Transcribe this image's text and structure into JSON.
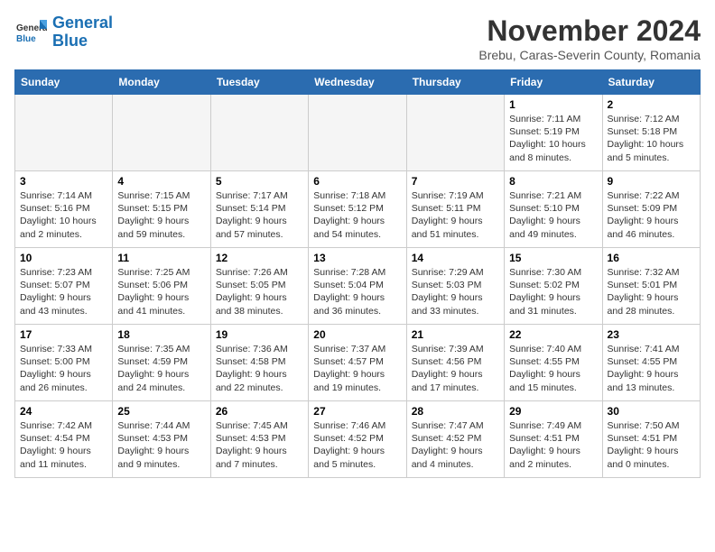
{
  "header": {
    "logo_line1": "General",
    "logo_line2": "Blue",
    "month_title": "November 2024",
    "subtitle": "Brebu, Caras-Severin County, Romania"
  },
  "weekdays": [
    "Sunday",
    "Monday",
    "Tuesday",
    "Wednesday",
    "Thursday",
    "Friday",
    "Saturday"
  ],
  "weeks": [
    [
      {
        "day": "",
        "info": ""
      },
      {
        "day": "",
        "info": ""
      },
      {
        "day": "",
        "info": ""
      },
      {
        "day": "",
        "info": ""
      },
      {
        "day": "",
        "info": ""
      },
      {
        "day": "1",
        "info": "Sunrise: 7:11 AM\nSunset: 5:19 PM\nDaylight: 10 hours and 8 minutes."
      },
      {
        "day": "2",
        "info": "Sunrise: 7:12 AM\nSunset: 5:18 PM\nDaylight: 10 hours and 5 minutes."
      }
    ],
    [
      {
        "day": "3",
        "info": "Sunrise: 7:14 AM\nSunset: 5:16 PM\nDaylight: 10 hours and 2 minutes."
      },
      {
        "day": "4",
        "info": "Sunrise: 7:15 AM\nSunset: 5:15 PM\nDaylight: 9 hours and 59 minutes."
      },
      {
        "day": "5",
        "info": "Sunrise: 7:17 AM\nSunset: 5:14 PM\nDaylight: 9 hours and 57 minutes."
      },
      {
        "day": "6",
        "info": "Sunrise: 7:18 AM\nSunset: 5:12 PM\nDaylight: 9 hours and 54 minutes."
      },
      {
        "day": "7",
        "info": "Sunrise: 7:19 AM\nSunset: 5:11 PM\nDaylight: 9 hours and 51 minutes."
      },
      {
        "day": "8",
        "info": "Sunrise: 7:21 AM\nSunset: 5:10 PM\nDaylight: 9 hours and 49 minutes."
      },
      {
        "day": "9",
        "info": "Sunrise: 7:22 AM\nSunset: 5:09 PM\nDaylight: 9 hours and 46 minutes."
      }
    ],
    [
      {
        "day": "10",
        "info": "Sunrise: 7:23 AM\nSunset: 5:07 PM\nDaylight: 9 hours and 43 minutes."
      },
      {
        "day": "11",
        "info": "Sunrise: 7:25 AM\nSunset: 5:06 PM\nDaylight: 9 hours and 41 minutes."
      },
      {
        "day": "12",
        "info": "Sunrise: 7:26 AM\nSunset: 5:05 PM\nDaylight: 9 hours and 38 minutes."
      },
      {
        "day": "13",
        "info": "Sunrise: 7:28 AM\nSunset: 5:04 PM\nDaylight: 9 hours and 36 minutes."
      },
      {
        "day": "14",
        "info": "Sunrise: 7:29 AM\nSunset: 5:03 PM\nDaylight: 9 hours and 33 minutes."
      },
      {
        "day": "15",
        "info": "Sunrise: 7:30 AM\nSunset: 5:02 PM\nDaylight: 9 hours and 31 minutes."
      },
      {
        "day": "16",
        "info": "Sunrise: 7:32 AM\nSunset: 5:01 PM\nDaylight: 9 hours and 28 minutes."
      }
    ],
    [
      {
        "day": "17",
        "info": "Sunrise: 7:33 AM\nSunset: 5:00 PM\nDaylight: 9 hours and 26 minutes."
      },
      {
        "day": "18",
        "info": "Sunrise: 7:35 AM\nSunset: 4:59 PM\nDaylight: 9 hours and 24 minutes."
      },
      {
        "day": "19",
        "info": "Sunrise: 7:36 AM\nSunset: 4:58 PM\nDaylight: 9 hours and 22 minutes."
      },
      {
        "day": "20",
        "info": "Sunrise: 7:37 AM\nSunset: 4:57 PM\nDaylight: 9 hours and 19 minutes."
      },
      {
        "day": "21",
        "info": "Sunrise: 7:39 AM\nSunset: 4:56 PM\nDaylight: 9 hours and 17 minutes."
      },
      {
        "day": "22",
        "info": "Sunrise: 7:40 AM\nSunset: 4:55 PM\nDaylight: 9 hours and 15 minutes."
      },
      {
        "day": "23",
        "info": "Sunrise: 7:41 AM\nSunset: 4:55 PM\nDaylight: 9 hours and 13 minutes."
      }
    ],
    [
      {
        "day": "24",
        "info": "Sunrise: 7:42 AM\nSunset: 4:54 PM\nDaylight: 9 hours and 11 minutes."
      },
      {
        "day": "25",
        "info": "Sunrise: 7:44 AM\nSunset: 4:53 PM\nDaylight: 9 hours and 9 minutes."
      },
      {
        "day": "26",
        "info": "Sunrise: 7:45 AM\nSunset: 4:53 PM\nDaylight: 9 hours and 7 minutes."
      },
      {
        "day": "27",
        "info": "Sunrise: 7:46 AM\nSunset: 4:52 PM\nDaylight: 9 hours and 5 minutes."
      },
      {
        "day": "28",
        "info": "Sunrise: 7:47 AM\nSunset: 4:52 PM\nDaylight: 9 hours and 4 minutes."
      },
      {
        "day": "29",
        "info": "Sunrise: 7:49 AM\nSunset: 4:51 PM\nDaylight: 9 hours and 2 minutes."
      },
      {
        "day": "30",
        "info": "Sunrise: 7:50 AM\nSunset: 4:51 PM\nDaylight: 9 hours and 0 minutes."
      }
    ]
  ]
}
